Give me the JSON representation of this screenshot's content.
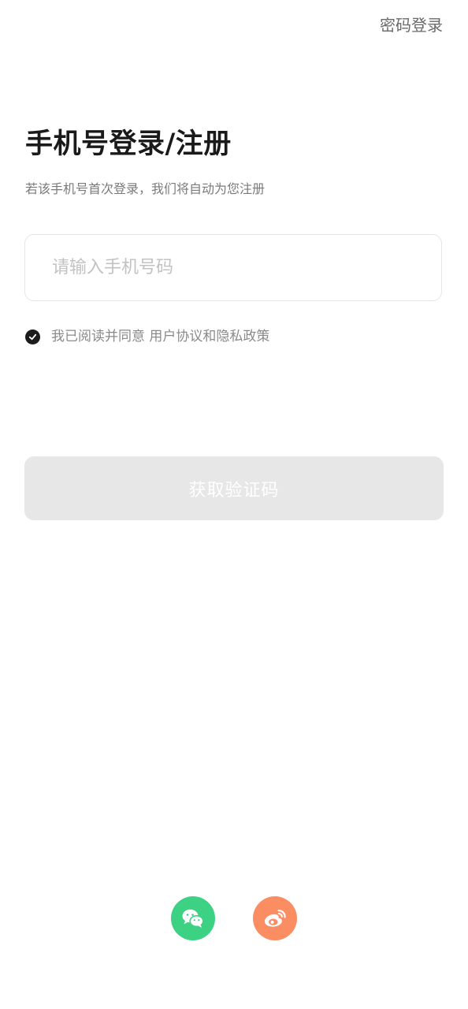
{
  "header": {
    "password_login_label": "密码登录"
  },
  "main": {
    "title": "手机号登录/注册",
    "subtitle": "若该手机号首次登录，我们将自动为您注册",
    "phone_input": {
      "placeholder": "请输入手机号码",
      "value": ""
    },
    "agreement": {
      "checked": true,
      "prefix": "我已阅读并同意 ",
      "user_agreement": "用户协议",
      "conjunction": "和",
      "privacy_policy": "隐私政策"
    },
    "get_code_button": "获取验证码"
  },
  "social_login": {
    "items": [
      {
        "icon": "wechat-icon",
        "color": "#3dd283"
      },
      {
        "icon": "weibo-icon",
        "color": "#fa8d62"
      }
    ]
  },
  "colors": {
    "title": "#1a1a1a",
    "secondary_text": "#7a7a7a",
    "input_border": "#e6e6e6",
    "disabled_button_bg": "#e7e7e7",
    "wechat": "#3dd283",
    "weibo": "#fa8d62"
  }
}
